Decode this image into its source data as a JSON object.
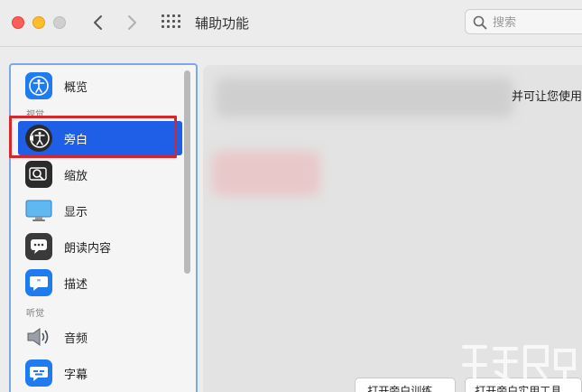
{
  "window": {
    "title": "辅助功能",
    "search_placeholder": "搜索"
  },
  "sidebar": {
    "sections": [
      {
        "label": "视觉"
      },
      {
        "label": "听觉"
      }
    ],
    "items": [
      {
        "label": "概览",
        "icon": "accessibility-icon"
      },
      {
        "label": "旁白",
        "icon": "voiceover-icon",
        "selected": true
      },
      {
        "label": "缩放",
        "icon": "zoom-icon"
      },
      {
        "label": "显示",
        "icon": "display-icon"
      },
      {
        "label": "朗读内容",
        "icon": "speech-icon"
      },
      {
        "label": "描述",
        "icon": "descriptions-icon"
      },
      {
        "label": "音频",
        "icon": "audio-speaker-icon"
      },
      {
        "label": "字幕",
        "icon": "captions-icon"
      }
    ]
  },
  "main": {
    "visible_text": "并可让您使用",
    "buttons": [
      {
        "label": "打开旁白训练..."
      },
      {
        "label": "打开旁白实用工具..."
      }
    ]
  },
  "colors": {
    "selection": "#1f5ee6",
    "highlight_border": "#d6262a",
    "sidebar_border": "#7ea7e6"
  }
}
